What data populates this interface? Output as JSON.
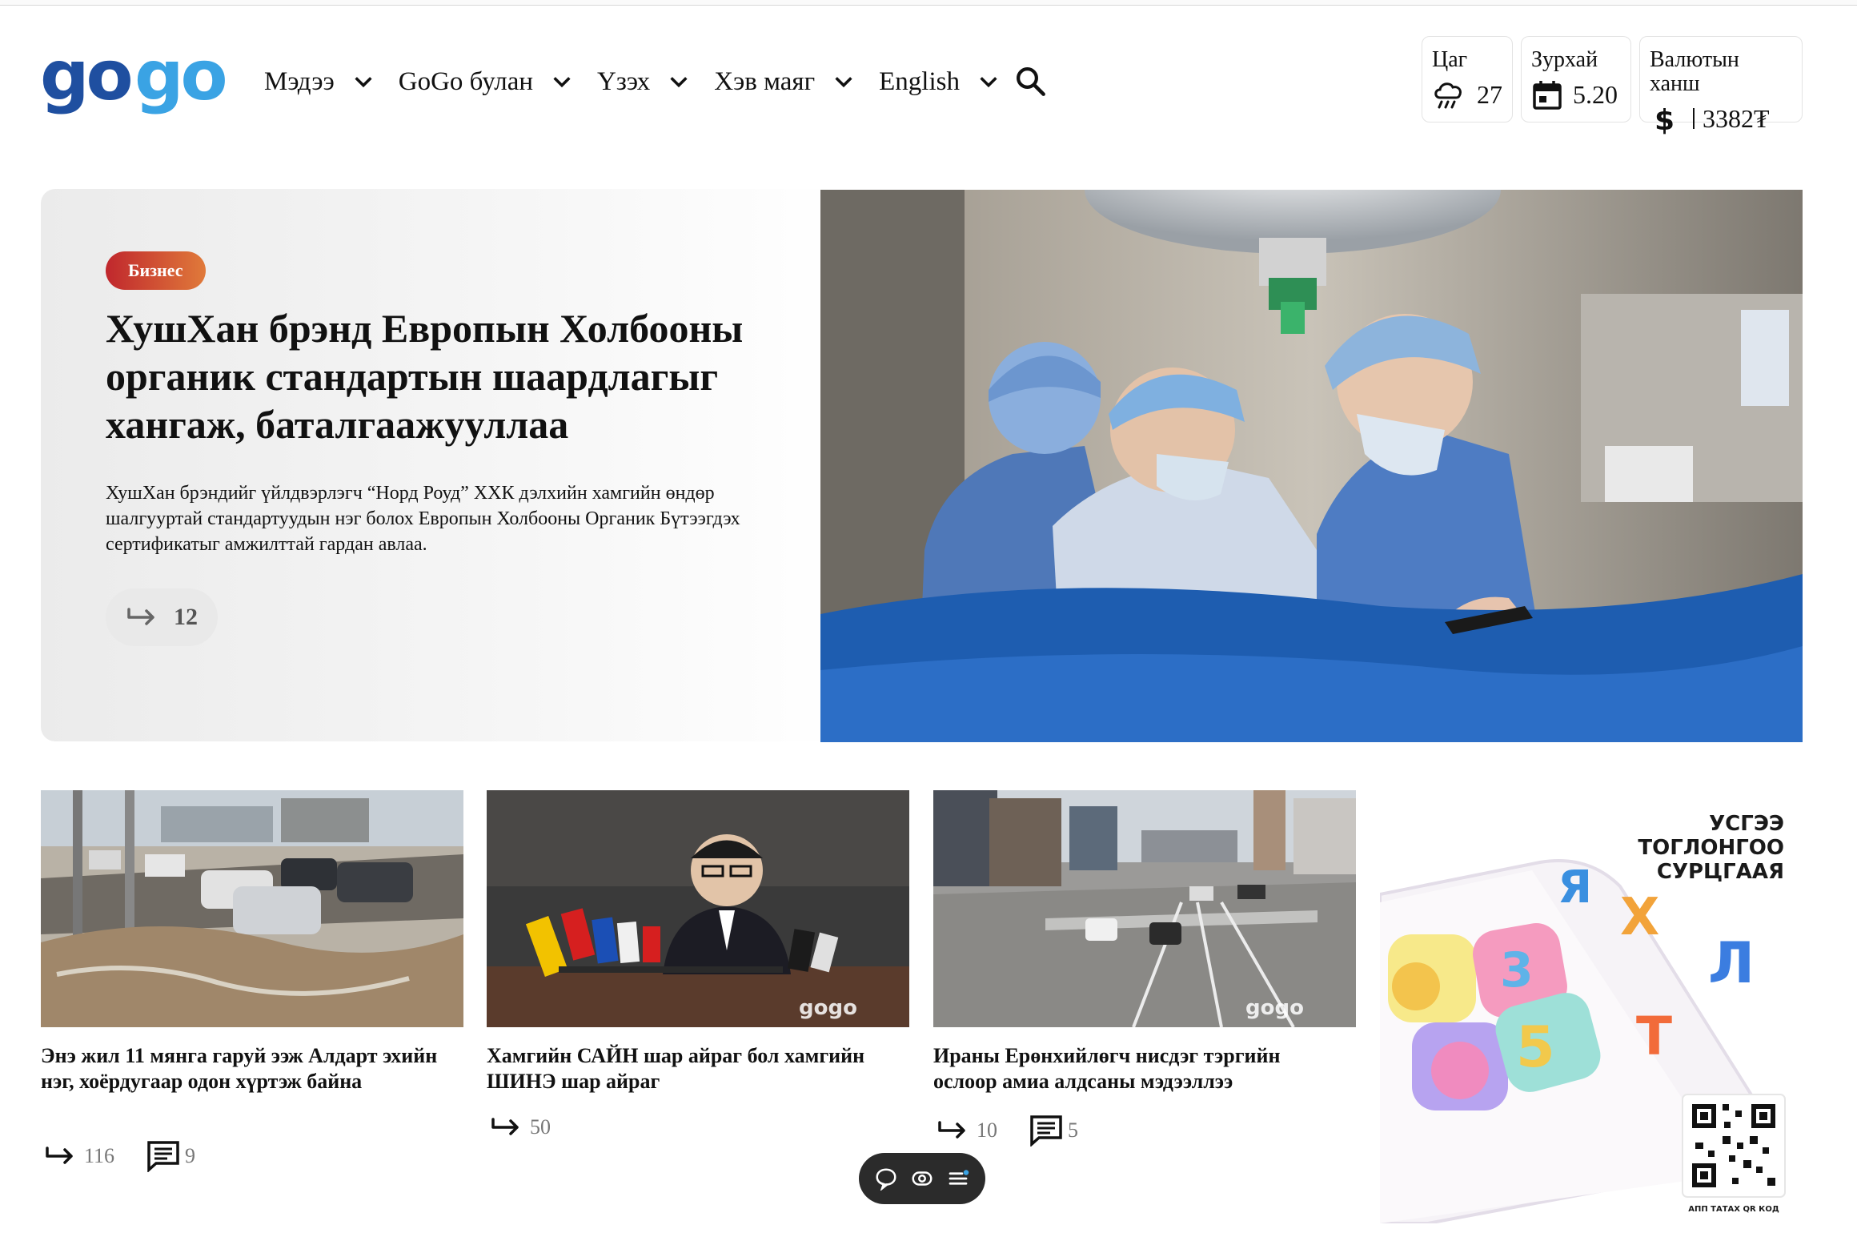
{
  "header": {
    "logo_text": "gogo",
    "brand_colors": {
      "dark_blue": "#1f4fa0",
      "light_blue": "#3aa3e4"
    },
    "nav": [
      {
        "label": "Мэдээ"
      },
      {
        "label": "GoGo булан"
      },
      {
        "label": "Үзэх"
      },
      {
        "label": "Хэв маяг"
      },
      {
        "label": "English"
      }
    ],
    "search_icon": "search-icon",
    "widgets": {
      "weather": {
        "label": "Цаг",
        "value": "27",
        "icon": "cloud-rain-icon"
      },
      "calendar": {
        "label": "Зурхай",
        "value": "5.20",
        "icon": "calendar-icon"
      },
      "currency": {
        "label": "Валютын ханш",
        "value": "3382₮",
        "icon": "dollar-icon"
      }
    }
  },
  "hero": {
    "category": "Бизнес",
    "title": "ХушХан брэнд Европын Холбооны органик стандартын шаардлагыг хангаж, баталгаажууллаа",
    "description": "ХушХан брэндийг үйлдвэрлэгч “Норд Роуд” ХХК дэлхийн хамгийн өндөр шалгууртай стандартуудын нэг болох Европын Холбооны Органик Бүтээгдэх сертификатыг амжилттай гардан авлаа.",
    "shares": "12",
    "image": "surgeons-operating-room-photo"
  },
  "articles": [
    {
      "title": "Энэ жил 11 мянга гаруй ээж Алдарт эхийн нэг, хоёрдугаар одон хүртэж байна",
      "shares": "116",
      "comments": "9",
      "image": "flooded-street-photo"
    },
    {
      "title": "Хамгийн САЙН шар айраг бол хамгийн ШИНЭ шар айраг",
      "shares": "50",
      "image": "press-conference-photo"
    },
    {
      "title": "Ираны Ерөнхийлөгч нисдэг тэргийн ослоор амиа алдсаны мэдээллээ",
      "shares": "10",
      "comments": "5",
      "image": "city-intersection-photo"
    }
  ],
  "ad": {
    "headline": "УСГЭЭ ТОГЛОНГОО СУРЦГААЯ",
    "qr_caption": "АПП ТАТАХ QR КОД",
    "letters": [
      "Я",
      "Х",
      "Л",
      "Т",
      "3",
      "5"
    ]
  },
  "photo_watermark": "gogo",
  "floatbar": {
    "icons": [
      "chat-icon",
      "eye-icon",
      "menu-icon"
    ]
  }
}
